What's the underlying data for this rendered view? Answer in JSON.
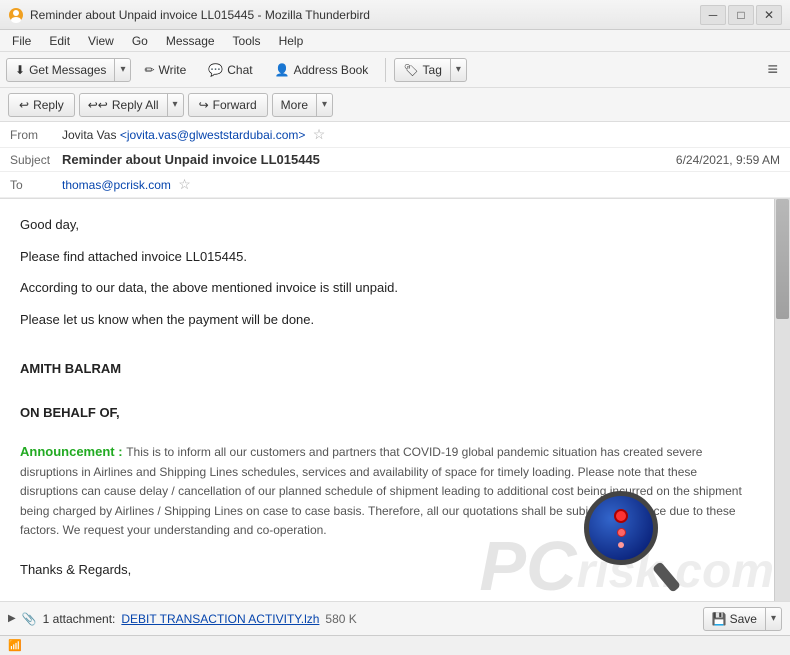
{
  "titlebar": {
    "title": "Reminder about Unpaid invoice LL015445 - Mozilla Thunderbird",
    "minimize": "─",
    "maximize": "□",
    "close": "✕"
  },
  "menubar": {
    "items": [
      "File",
      "Edit",
      "View",
      "Go",
      "Message",
      "Tools",
      "Help"
    ]
  },
  "toolbar": {
    "get_messages": "Get Messages",
    "write": "Write",
    "chat": "Chat",
    "address_book": "Address Book",
    "tag": "Tag"
  },
  "action_bar": {
    "reply": "Reply",
    "reply_all": "Reply All",
    "forward": "Forward",
    "more": "More"
  },
  "email": {
    "from_label": "From",
    "from_name": "Jovita Vas",
    "from_email": "<jovita.vas@glweststardubai.com>",
    "subject_label": "Subject",
    "subject": "Reminder about Unpaid invoice LL015445",
    "date": "6/24/2021, 9:59 AM",
    "to_label": "To",
    "to": "thomas@pcrisk.com",
    "body_greeting": "Good day,",
    "body_para1": "Please find attached invoice LL015445.",
    "body_para2": "According to our data, the above mentioned invoice is still unpaid.",
    "body_para3": "Please let us know when the payment will be done.",
    "signature_line1": "AMITH BALRAM",
    "signature_line2": "ON BEHALF OF,",
    "announcement_label": "Announcement :",
    "announcement_text": "This is to inform all our customers and partners that COVID-19 global pandemic situation has created severe disruptions in Airlines and Shipping Lines schedules, services and availability of space for timely loading. Please note that these disruptions can cause delay / cancellation of our planned schedule of shipment leading to additional cost being incurred on the shipment being charged by Airlines / Shipping Lines on case to case basis. Therefore, all our quotations shall be subject to variance due to these factors. We request your understanding and co-operation.",
    "thanks": "Thanks & Regards,"
  },
  "attachment": {
    "expand_icon": "▶",
    "paperclip": "📎",
    "count": "1 attachment:",
    "filename": "DEBIT TRANSACTION ACTIVITY.lzh",
    "size": "580 K",
    "save_label": "Save"
  },
  "status_bar": {
    "wifi_icon": "📶"
  }
}
